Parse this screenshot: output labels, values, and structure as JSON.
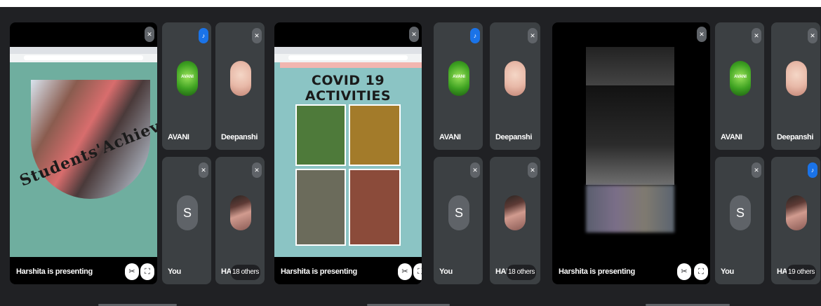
{
  "panels": [
    {
      "presenting_label": "Harshita is presenting",
      "slide_text": "Students'Achievement",
      "tiles": [
        {
          "name": "AVANI",
          "avatar_text": "AVANI",
          "mic": "on"
        },
        {
          "name": "Deepanshi",
          "mic": "off"
        },
        {
          "name": "You",
          "avatar_text": "S",
          "mic": "off"
        },
        {
          "name": "HARS",
          "mic": "off",
          "others": "18 others"
        }
      ]
    },
    {
      "presenting_label": "Harshita is presenting",
      "slide_text": "COVID 19 ACTIVITIES",
      "tiles": [
        {
          "name": "AVANI",
          "avatar_text": "AVANI",
          "mic": "on"
        },
        {
          "name": "Deepanshi",
          "mic": "off"
        },
        {
          "name": "You",
          "avatar_text": "S",
          "mic": "off"
        },
        {
          "name": "HARS",
          "mic": "off",
          "others": "18 others"
        }
      ]
    },
    {
      "presenting_label": "Harshita is presenting",
      "tiles": [
        {
          "name": "AVANI",
          "avatar_text": "AVANI",
          "mic": "off"
        },
        {
          "name": "Deepanshi",
          "mic": "off"
        },
        {
          "name": "You",
          "avatar_text": "S",
          "mic": "off"
        },
        {
          "name": "HARS",
          "mic": "on",
          "others": "19 others"
        }
      ]
    }
  ],
  "colors": {
    "background": "#202124",
    "tile": "#3c4043",
    "accent": "#1a73e8"
  },
  "icons": {
    "mic_off": "mic-off-icon",
    "mic_on": "mic-on-icon",
    "pin": "pin-icon",
    "fullscreen": "fullscreen-icon"
  }
}
